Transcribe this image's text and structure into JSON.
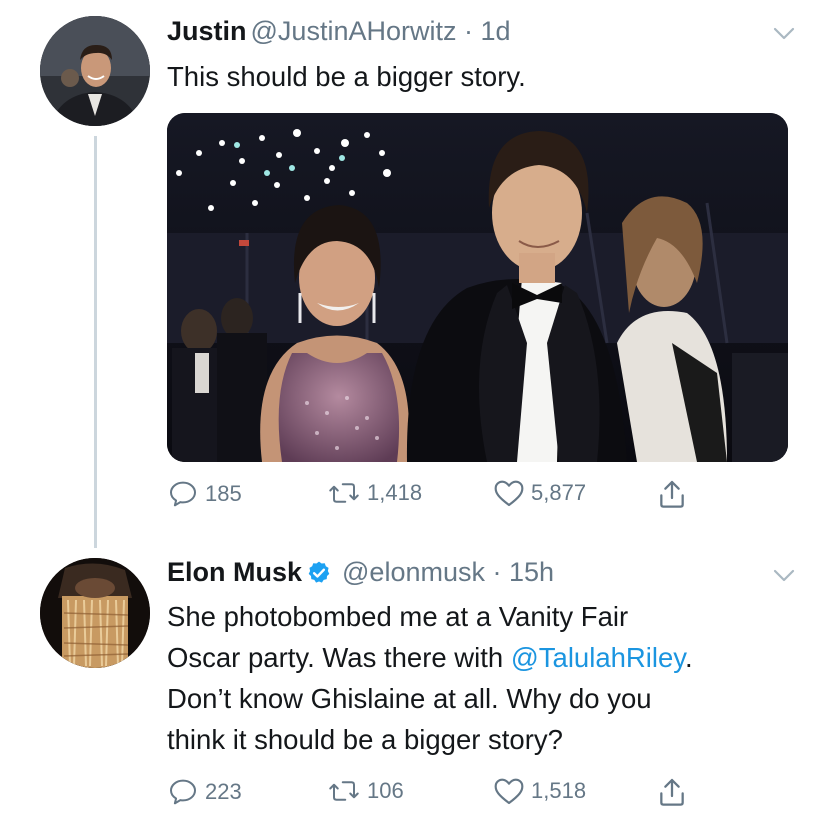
{
  "tweet1": {
    "author_name": "Justin",
    "author_handle": "@JustinAHorwitz",
    "time": "· 1d",
    "text": "This should be a bigger story.",
    "replies": "185",
    "retweets": "1,418",
    "likes": "5,877",
    "avatar_icon": "person-portrait",
    "media_icon": "photo-party-couple"
  },
  "tweet2": {
    "author_name": "Elon Musk",
    "author_handle": "@elonmusk",
    "time": "· 15h",
    "verified": true,
    "text_lines": [
      "She photobombed me at a Vanity Fair",
      "Oscar party. Was there with ",
      "Don’t know Ghislaine at all. Why do you",
      "think it should be a bigger story?"
    ],
    "mention": "@TalulahRiley",
    "after_mention": ".",
    "replies": "223",
    "retweets": "106",
    "likes": "1,518",
    "avatar_icon": "textured-art-portrait"
  },
  "colors": {
    "text": "#14171a",
    "secondary": "#657786",
    "link": "#1b95e0",
    "verified": "#1da1f2",
    "thread_line": "#ccd6dd"
  }
}
